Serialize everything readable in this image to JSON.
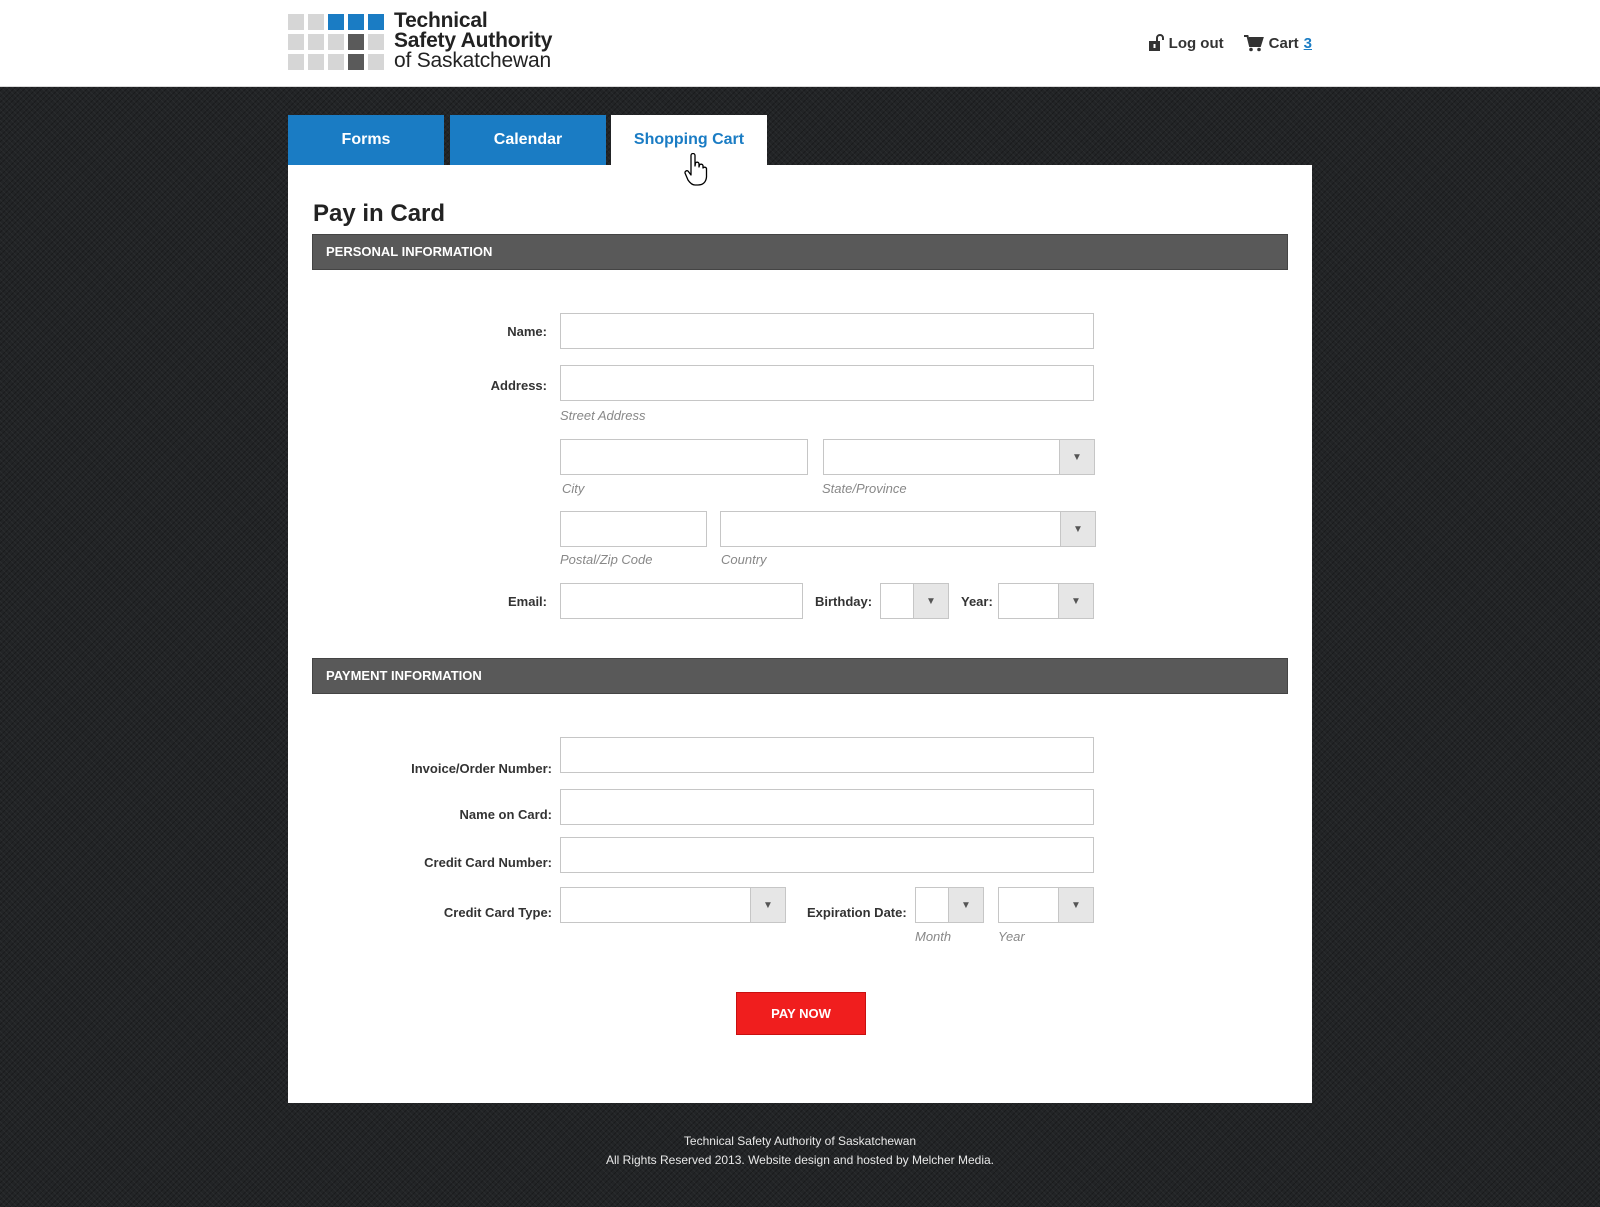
{
  "header": {
    "logo_lines": [
      "Technical",
      "Safety Authority",
      "of Saskatchewan"
    ],
    "logout_label": "Log out",
    "cart_label": "Cart",
    "cart_count": "3",
    "colors": {
      "brand_blue": "#1a7cc4",
      "logo_gray": "#d6d6d6",
      "logo_dark": "#5a5a5a"
    }
  },
  "tabs": [
    {
      "label": "Forms",
      "active": false
    },
    {
      "label": "Calendar",
      "active": false
    },
    {
      "label": "Shopping Cart",
      "active": true
    }
  ],
  "page": {
    "title": "Pay in Card",
    "personal_section": "PERSONAL INFORMATION",
    "payment_section": "PAYMENT INFORMATION"
  },
  "personal": {
    "name_label": "Name:",
    "name_value": "",
    "address_label": "Address:",
    "street_value": "",
    "street_hint": "Street Address",
    "city_value": "",
    "city_hint": "City",
    "state_value": "",
    "state_hint": "State/Province",
    "postal_value": "",
    "postal_hint": "Postal/Zip Code",
    "country_value": "",
    "country_hint": "Country",
    "email_label": "Email:",
    "email_value": "",
    "birthday_label": "Birthday:",
    "birthday_value": "",
    "year_label": "Year:",
    "year_value": ""
  },
  "payment": {
    "invoice_label": "Invoice/Order Number:",
    "invoice_value": "",
    "card_name_label": "Name on Card:",
    "card_name_value": "",
    "card_number_label": "Credit Card Number:",
    "card_number_value": "",
    "card_type_label": "Credit Card Type:",
    "card_type_value": "",
    "expiration_label": "Expiration Date:",
    "exp_month_value": "",
    "exp_month_hint": "Month",
    "exp_year_value": "",
    "exp_year_hint": "Year",
    "pay_button": "PAY NOW",
    "pay_button_color": "#f01e1e"
  },
  "footer": {
    "line1": "Technical Safety Authority of Saskatchewan",
    "line2": "All Rights Reserved 2013. Website design and hosted by Melcher Media."
  },
  "icons": {
    "logout": "unlock-icon",
    "cart": "cart-icon",
    "dropdown": "triangle-down-icon",
    "pointer": "hand-pointer-icon"
  }
}
